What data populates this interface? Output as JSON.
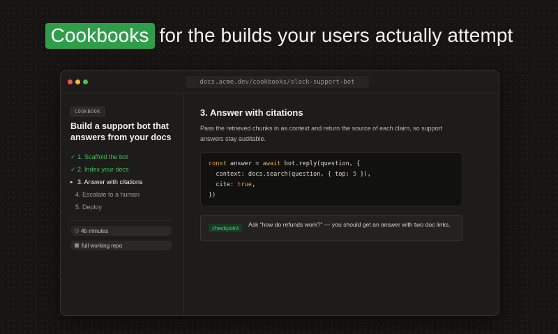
{
  "headline": {
    "highlight": "Cookbooks",
    "rest": "for the builds your users actually attempt"
  },
  "window": {
    "url": "docs.acme.dev/cookbooks/slack-support-bot"
  },
  "sidebar": {
    "tag": "COOKBOOK",
    "title": "Build a support bot that answers from your docs",
    "steps": [
      {
        "mark": "✓",
        "label": "1. Scaffold the bot",
        "state": "done"
      },
      {
        "mark": "✓",
        "label": "2. Index your docs",
        "state": "done"
      },
      {
        "mark": "▸",
        "label": "3. Answer with citations",
        "state": "current"
      },
      {
        "mark": "",
        "label": "4. Escalate to a human",
        "state": "pending"
      },
      {
        "mark": "",
        "label": "5. Deploy",
        "state": "pending"
      }
    ],
    "meta": {
      "time_icon": "clock-icon",
      "time": "45 minutes",
      "repo_icon": "square-icon",
      "repo": "full working repo"
    }
  },
  "content": {
    "title": "3. Answer with citations",
    "description": "Pass the retrieved chunks in as context and return the source of each claim, so support answers stay auditable.",
    "code": {
      "l1_kw1": "const",
      "l1_a": " answer = ",
      "l1_kw2": "await",
      "l1_b": " bot.reply(question, {",
      "l2_a": "  context: docs.search(question, { top: ",
      "l2_num": "5",
      "l2_b": " }),",
      "l3_a": "  cite: ",
      "l3_bool": "true",
      "l3_b": ",",
      "l4": "})"
    },
    "checkpoint": {
      "label": "checkpoint",
      "text": "Ask “how do refunds work?” — you should get an answer with two doc links."
    }
  },
  "colors": {
    "accent_green": "#2f9e4b",
    "done_green": "#44bd5a",
    "code_keyword": "#e3a93d",
    "background": "#161514"
  }
}
